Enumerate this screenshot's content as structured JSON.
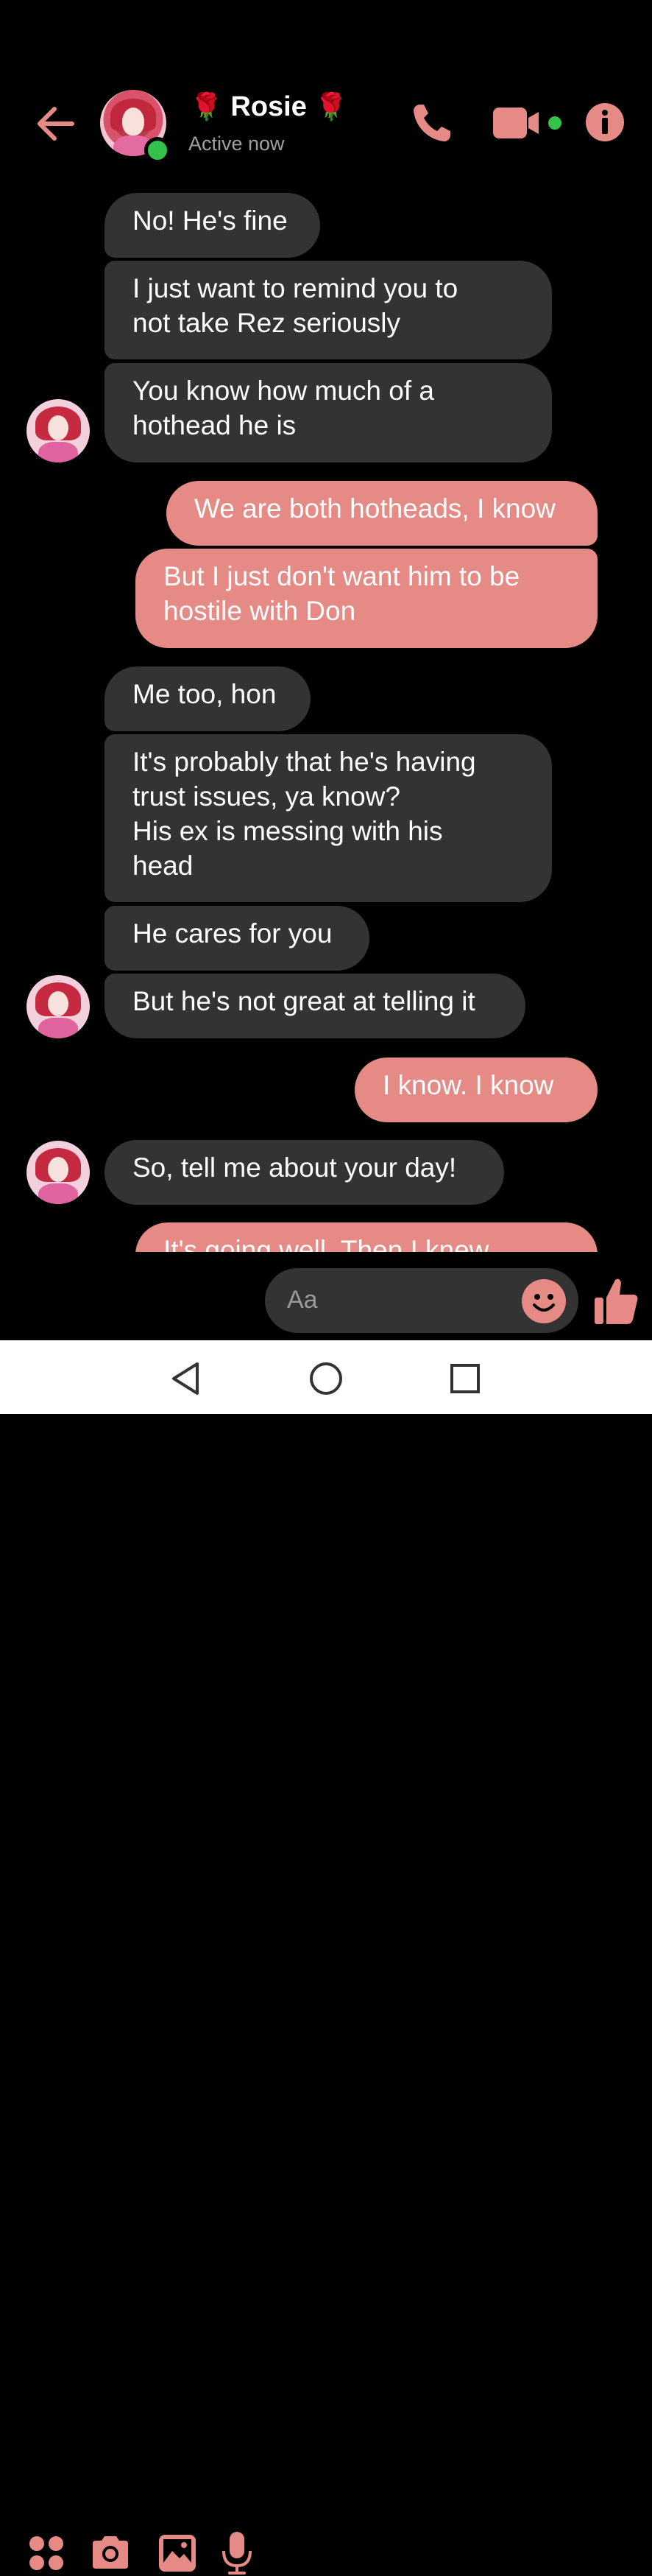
{
  "header": {
    "name": "Rosie",
    "name_prefix_emoji": "🌹",
    "name_suffix_emoji": "🌹",
    "status": "Active now",
    "icons": [
      "back-arrow-icon",
      "phone-icon",
      "video-icon",
      "info-icon"
    ]
  },
  "accent_color": "#e68a86",
  "messages": [
    {
      "side": "in",
      "text": "No! He's fine"
    },
    {
      "side": "in",
      "text": "I just want to remind you to\nnot take Rez seriously"
    },
    {
      "side": "in",
      "text": "You know how much of a\nhothead he is"
    },
    {
      "side": "out",
      "text": "We are both hotheads, I know"
    },
    {
      "side": "out",
      "text": "But I just don't want him to be\nhostile with Don"
    },
    {
      "side": "in",
      "text": "Me too, hon"
    },
    {
      "side": "in",
      "text": "It's probably that he's having\ntrust issues, ya know?\nHis ex is messing with his\nhead"
    },
    {
      "side": "in",
      "text": "He cares for you"
    },
    {
      "side": "in",
      "text": "But he's not great at telling it"
    },
    {
      "side": "out",
      "text": "I know. I know"
    },
    {
      "side": "in",
      "text": "So, tell me about your day!"
    },
    {
      "side": "out",
      "text": "It's going well. Then I knew"
    }
  ],
  "composer": {
    "placeholder": "Aa",
    "icons": [
      "apps-icon",
      "camera-icon",
      "gallery-icon",
      "microphone-icon",
      "emoji-icon",
      "thumbs-up-icon"
    ]
  },
  "navigation": {
    "icons": [
      "nav-back-icon",
      "nav-home-icon",
      "nav-recents-icon"
    ]
  }
}
